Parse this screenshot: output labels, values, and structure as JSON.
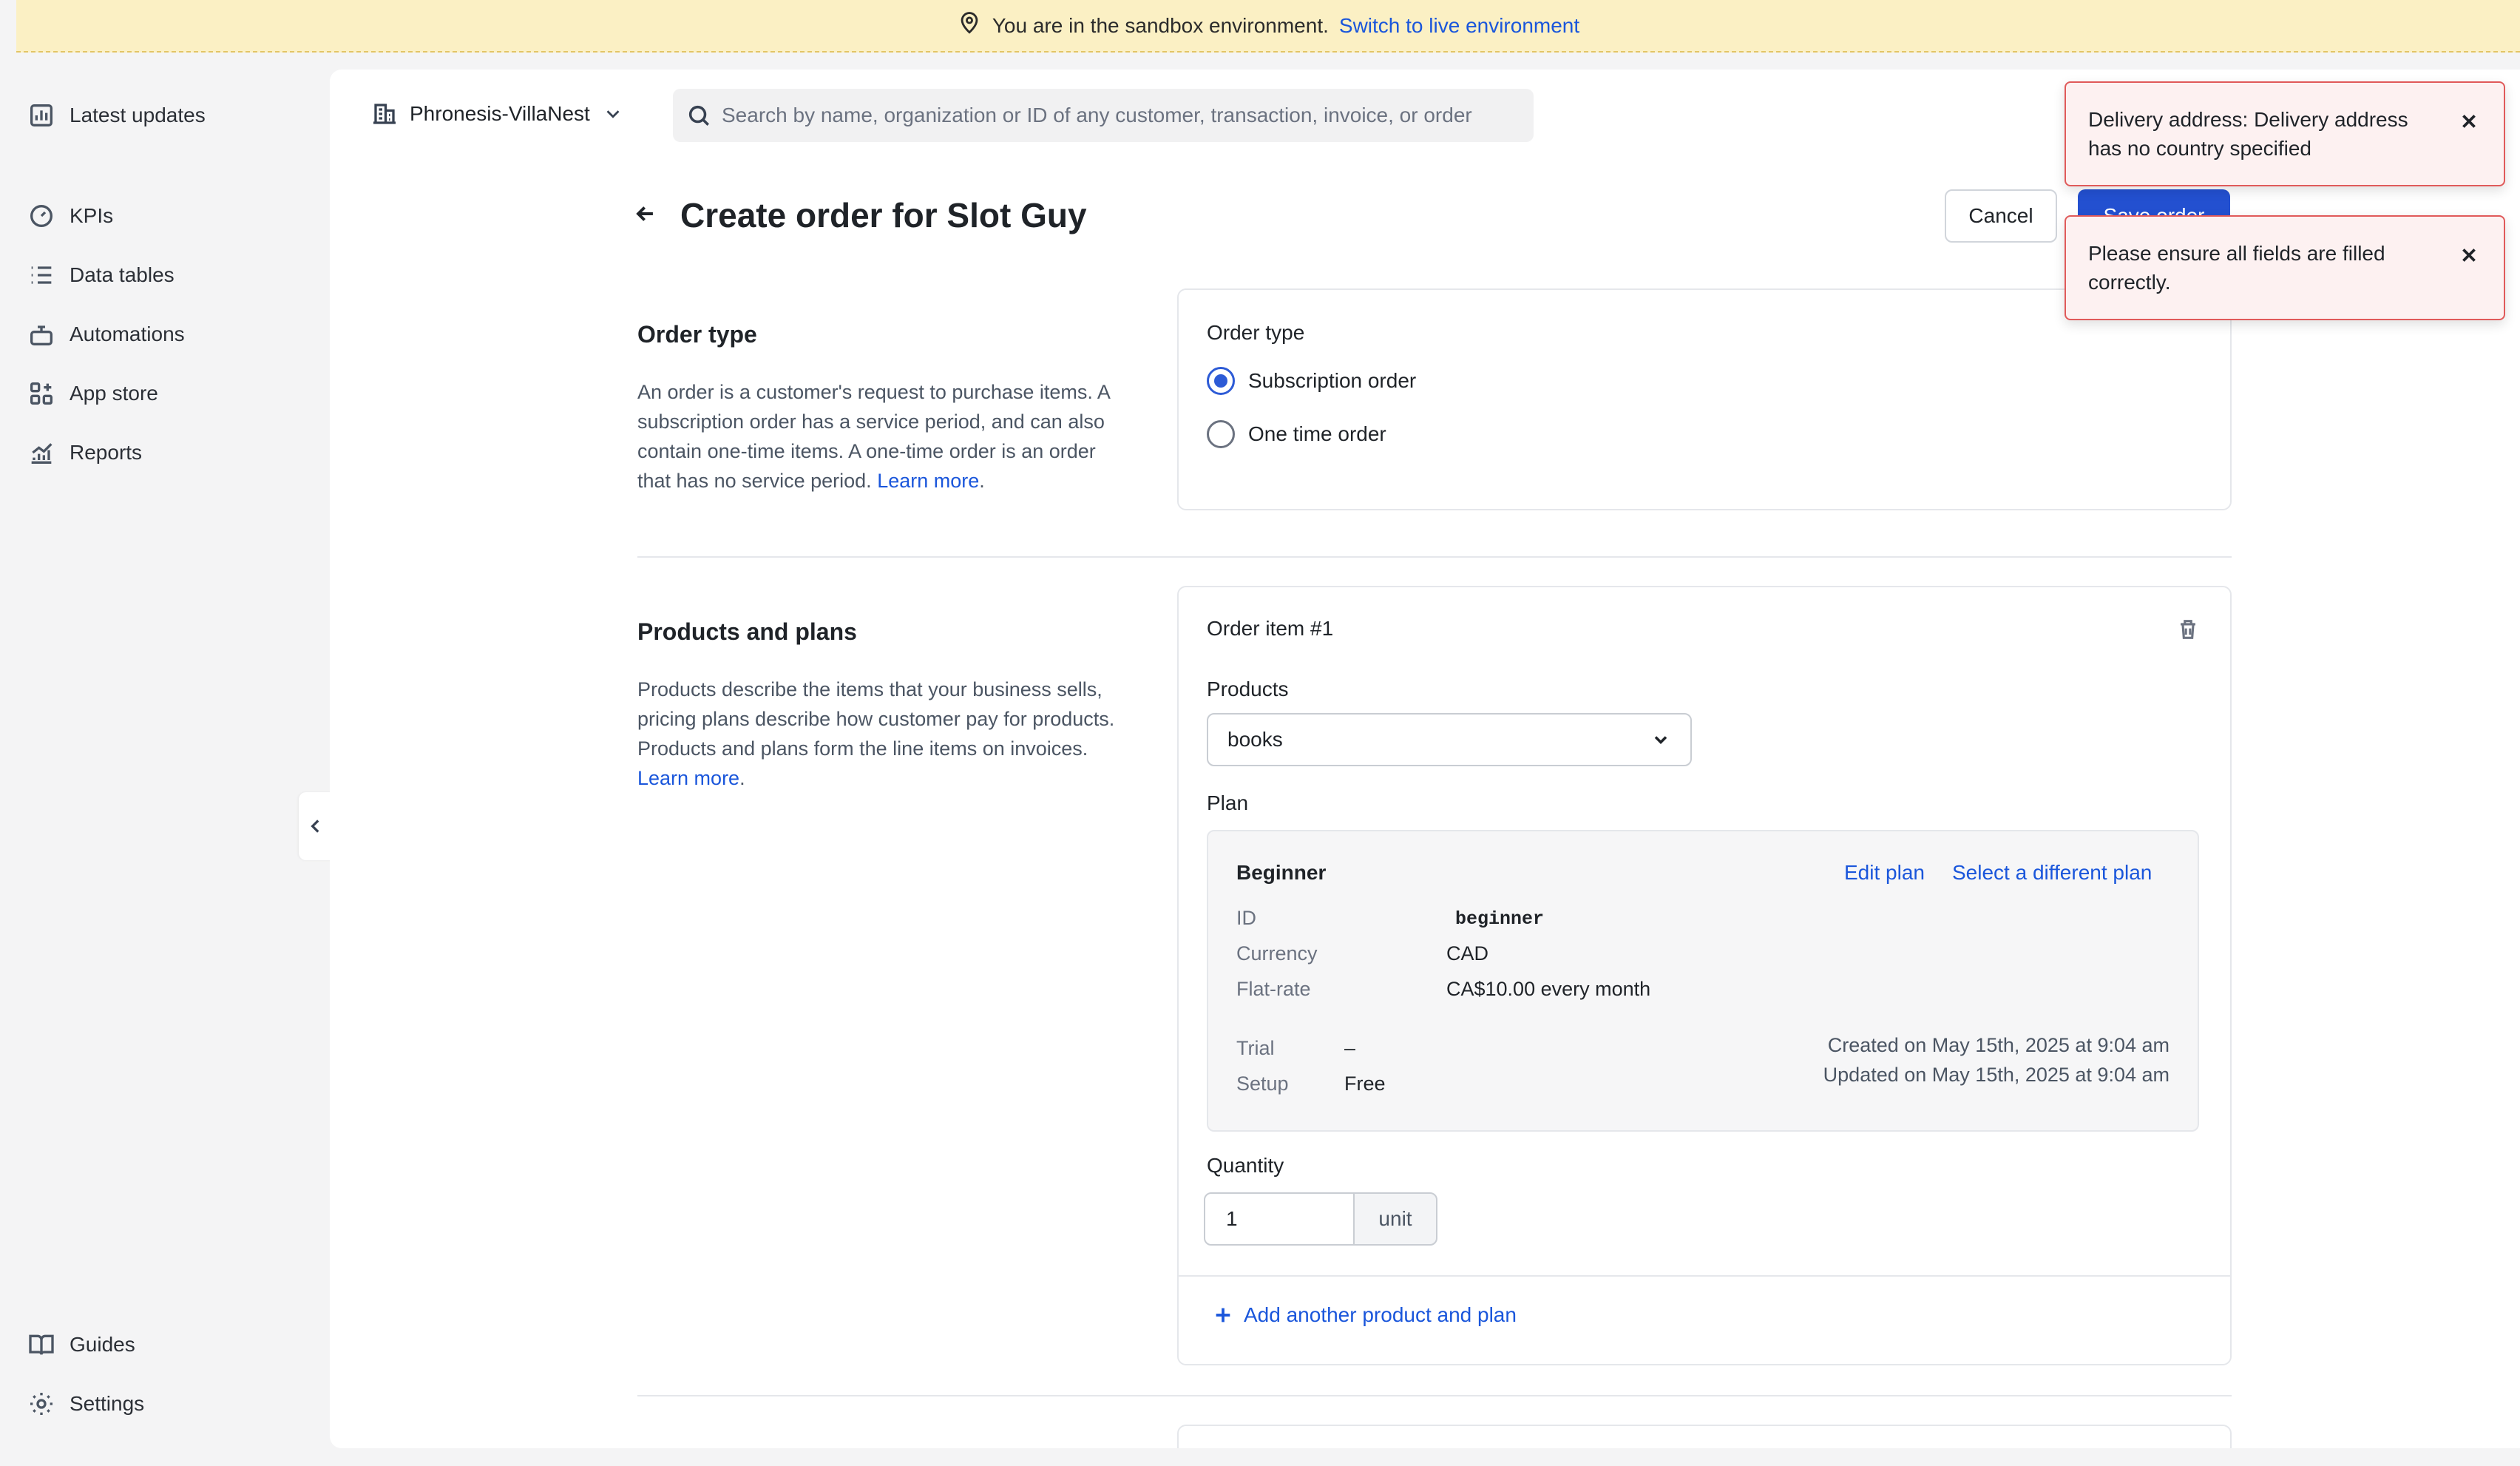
{
  "banner": {
    "text": "You are in the sandbox environment.",
    "link": "Switch to live environment"
  },
  "sidebar": {
    "items": [
      {
        "label": "Latest updates",
        "icon": "chart-bar-icon"
      },
      {
        "label": "KPIs",
        "icon": "gauge-icon"
      },
      {
        "label": "Data tables",
        "icon": "list-icon"
      },
      {
        "label": "Automations",
        "icon": "robot-icon"
      },
      {
        "label": "App store",
        "icon": "grid-plus-icon"
      },
      {
        "label": "Reports",
        "icon": "chart-line-icon"
      }
    ],
    "bottom_items": [
      {
        "label": "Guides",
        "icon": "book-icon"
      },
      {
        "label": "Settings",
        "icon": "gear-icon"
      }
    ]
  },
  "header": {
    "org_name": "Phronesis-VillaNest",
    "search_placeholder": "Search by name, organization or ID of any customer, transaction, invoice, or order"
  },
  "page": {
    "title": "Create order for Slot Guy",
    "cancel_label": "Cancel",
    "save_label": "Save order"
  },
  "order_type_section": {
    "title": "Order type",
    "description": "An order is a customer's request to purchase items. A subscription order has a service period, and can also contain one-time items. A one-time order is an order that has no service period.",
    "learn_more": "Learn more",
    "card_label": "Order type",
    "options": [
      {
        "label": "Subscription order",
        "selected": true
      },
      {
        "label": "One time order",
        "selected": false
      }
    ]
  },
  "products_section": {
    "title": "Products and plans",
    "description": "Products describe the items that your business sells, pricing plans describe how customer pay for products. Products and plans form the line items on invoices.",
    "learn_more": "Learn more",
    "item_title": "Order item #1",
    "products_label": "Products",
    "product_selected": "books",
    "plan_label": "Plan",
    "plan": {
      "name": "Beginner",
      "edit_link": "Edit plan",
      "select_link": "Select a different plan",
      "id_key": "ID",
      "id_value": "beginner",
      "currency_key": "Currency",
      "currency_value": "CAD",
      "flat_rate_key": "Flat-rate",
      "flat_rate_value": "CA$10.00 every month",
      "trial_key": "Trial",
      "trial_value": "–",
      "setup_key": "Setup",
      "setup_value": "Free",
      "created": "Created on May 15th, 2025 at 9:04 am",
      "updated": "Updated on May 15th, 2025 at 9:04 am"
    },
    "quantity_label": "Quantity",
    "quantity_value": "1",
    "quantity_unit": "unit",
    "add_link": "Add another product and plan"
  },
  "toasts": [
    {
      "text": "Delivery address: Delivery address has no country specified"
    },
    {
      "text": "Please ensure all fields are filled correctly."
    }
  ],
  "colors": {
    "accent": "#2350d0",
    "link": "#1a56db",
    "banner_bg": "#fbf0c4",
    "toast_border": "#e05a5a",
    "toast_bg": "#fdf1f1"
  }
}
